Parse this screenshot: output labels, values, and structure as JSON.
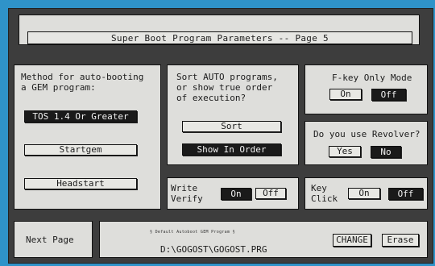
{
  "title": "Super Boot Program Parameters -- Page 5",
  "autoboot": {
    "label": "Method for auto-booting\na GEM program:",
    "options": [
      "TOS 1.4 Or Greater",
      "Startgem",
      "Headstart"
    ]
  },
  "sort": {
    "label": "Sort AUTO programs,\nor show true order\nof execution?",
    "options": [
      "Sort",
      "Show In Order"
    ]
  },
  "fkey": {
    "label": "F-key Only Mode",
    "on": "On",
    "off": "Off"
  },
  "revolver": {
    "label": "Do you use Revolver?",
    "yes": "Yes",
    "no": "No"
  },
  "write_verify": {
    "label": "Write\nVerify",
    "on": "On",
    "off": "Off"
  },
  "key_click": {
    "label": "Key\nClick",
    "on": "On",
    "off": "Off"
  },
  "footer": {
    "next_page": "Next Page",
    "default_caption": "§ Default Autoboot GEM Program §",
    "path": "D:\\GOGOST\\GOGOST.PRG",
    "change": "CHANGE",
    "erase": "Erase"
  },
  "colors": {
    "background": "#2f93c9",
    "frame": "#3d3d3d",
    "panel": "#dededb",
    "selected": "#1a1a1a"
  }
}
